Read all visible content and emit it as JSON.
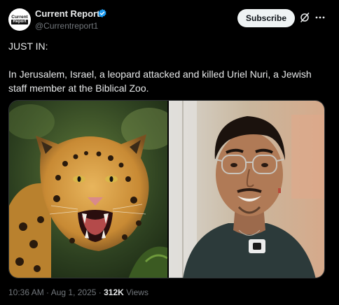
{
  "account": {
    "display_name": "Current Report",
    "handle": "@Currentreport1",
    "avatar_line1": "Current",
    "avatar_line2": "Report",
    "verified_color": "#1d9bf0"
  },
  "header": {
    "subscribe_label": "Subscribe",
    "icons": [
      "grok-icon",
      "more-icon"
    ]
  },
  "tweet": {
    "line1": "JUST IN:",
    "body": "In Jerusalem, Israel, a leopard attacked and killed Uriel Nuri, a Jewish staff member at the Biblical Zoo."
  },
  "meta": {
    "time": "10:36 AM",
    "sep1": " · ",
    "date": "Aug 1, 2025",
    "sep2": " · ",
    "views_count": "312K",
    "views_label": " Views"
  },
  "colors": {
    "background": "#000000",
    "text": "#e7e9ea",
    "muted": "#71767b",
    "button_bg": "#eff3f4"
  }
}
